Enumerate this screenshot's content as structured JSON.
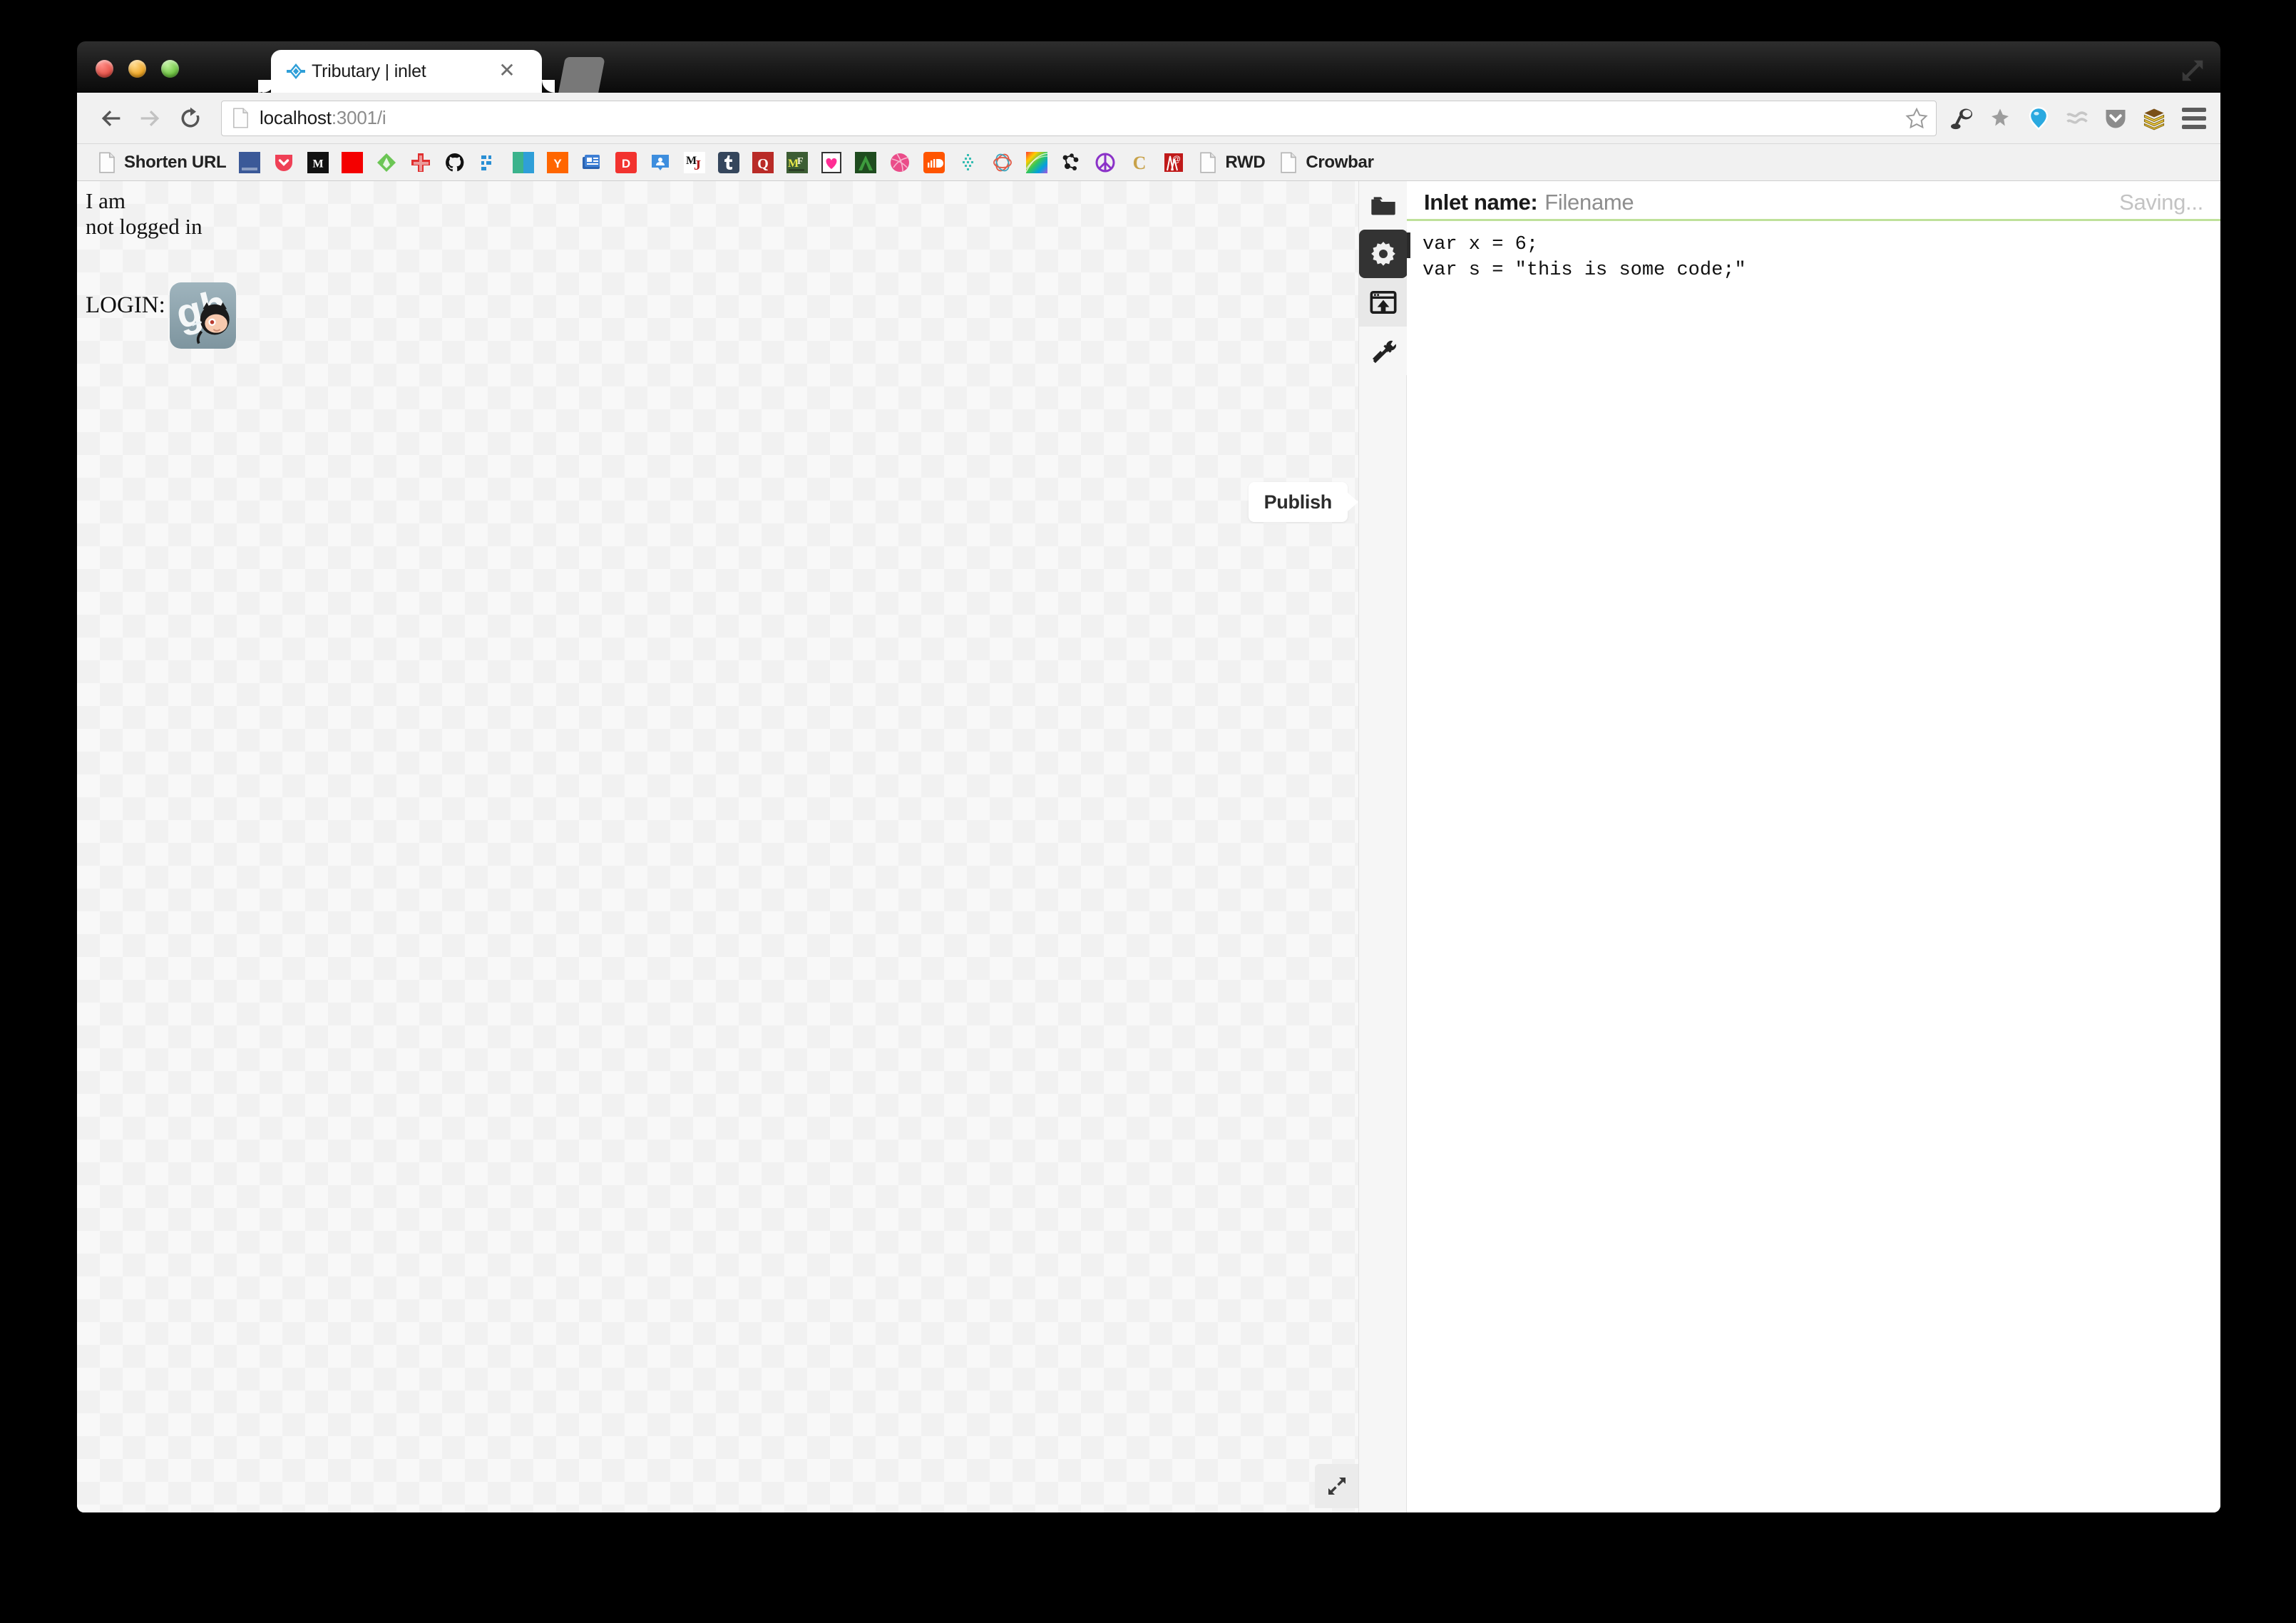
{
  "window": {
    "traffic_lights": [
      "close",
      "minimize",
      "zoom"
    ],
    "fullscreen_icon": "fullscreen-expand-icon"
  },
  "tab": {
    "favicon": "tributary-diamond-icon",
    "title": "Tributary | inlet",
    "close_icon": "close-icon",
    "new_tab_icon": "new-tab-stub"
  },
  "navbar": {
    "back_icon": "back-arrow-icon",
    "forward_icon": "forward-arrow-icon",
    "reload_icon": "reload-icon",
    "page_icon": "page-document-icon",
    "url_host": "localhost",
    "url_path": ":3001/i",
    "url_full": "localhost:3001/i",
    "star_icon": "bookmark-star-icon",
    "menu_icon": "hamburger-menu-icon",
    "extensions": [
      {
        "name": "desk-lamp-icon",
        "color": "#3c3c3c"
      },
      {
        "name": "pushpin-icon",
        "color": "#9a9a9a"
      },
      {
        "name": "blue-teardrop-icon",
        "color": "#1f9fe0"
      },
      {
        "name": "wavy-lines-icon",
        "color": "#c2c2c2"
      },
      {
        "name": "pocket-icon",
        "color": "#8a8a8a"
      },
      {
        "name": "layer-cake-icon",
        "color": "#d8b64a"
      }
    ]
  },
  "bookmarks": [
    {
      "name": "shorten-url",
      "label": "Shorten URL",
      "icon": "page-document-icon",
      "color": "#ffffff"
    },
    {
      "name": "facebook",
      "label": "",
      "icon": "facebook-icon",
      "color": "#3b5998"
    },
    {
      "name": "pocket",
      "label": "",
      "icon": "pocket-shield-icon",
      "color": "#ef4056"
    },
    {
      "name": "medium",
      "label": "",
      "icon": "medium-m-icon",
      "color": "#111111"
    },
    {
      "name": "red-square",
      "label": "",
      "icon": "red-square-icon",
      "color": "#f40000"
    },
    {
      "name": "feedly",
      "label": "",
      "icon": "feedly-leaf-icon",
      "color": "#6cc655"
    },
    {
      "name": "red-cross",
      "label": "",
      "icon": "red-cross-icon",
      "color": "#e03030"
    },
    {
      "name": "github",
      "label": "",
      "icon": "github-octocat-icon",
      "color": "#111111"
    },
    {
      "name": "blue-dots",
      "label": "",
      "icon": "blue-dots-grid-icon",
      "color": "#2a8fd4"
    },
    {
      "name": "teal-blue-split",
      "label": "",
      "icon": "split-rect-icon",
      "color": "#3bb38c"
    },
    {
      "name": "hacker-news",
      "label": "",
      "icon": "hacker-news-y-icon",
      "color": "#ff6600"
    },
    {
      "name": "news-reader",
      "label": "",
      "icon": "newspaper-icon",
      "color": "#2a62b0"
    },
    {
      "name": "dribbble-d",
      "label": "",
      "icon": "letter-d-icon",
      "color": "#f2332f"
    },
    {
      "name": "slideshare",
      "label": "",
      "icon": "presentation-icon",
      "color": "#3e8ede"
    },
    {
      "name": "mj",
      "label": "",
      "icon": "mj-monogram-icon",
      "color": "#ffffff"
    },
    {
      "name": "tumblr",
      "label": "",
      "icon": "tumblr-t-icon",
      "color": "#35465c"
    },
    {
      "name": "quora",
      "label": "",
      "icon": "quora-q-icon",
      "color": "#b92b27"
    },
    {
      "name": "mf",
      "label": "",
      "icon": "mf-monogram-icon",
      "color": "#3c5d34"
    },
    {
      "name": "heart",
      "label": "",
      "icon": "pink-heart-icon",
      "color": "#ff2d94"
    },
    {
      "name": "green-a",
      "label": "",
      "icon": "green-triangle-a-icon",
      "color": "#1f4c1f"
    },
    {
      "name": "dribbble",
      "label": "",
      "icon": "dribbble-ball-icon",
      "color": "#ea4c89"
    },
    {
      "name": "soundcloud",
      "label": "",
      "icon": "soundcloud-icon",
      "color": "#ff5500"
    },
    {
      "name": "teal-dots",
      "label": "",
      "icon": "teal-dot-grid-icon",
      "color": "#35bdb2"
    },
    {
      "name": "knot",
      "label": "",
      "icon": "knot-loop-icon",
      "color": "#e05a47"
    },
    {
      "name": "spectrum",
      "label": "",
      "icon": "rainbow-swirl-icon",
      "color": "#8ad0e8"
    },
    {
      "name": "nodes",
      "label": "",
      "icon": "node-graph-icon",
      "color": "#1b1b1b"
    },
    {
      "name": "peace",
      "label": "",
      "icon": "peace-sign-icon",
      "color": "#8b32c8"
    },
    {
      "name": "codepen-c",
      "label": "",
      "icon": "letter-c-icon",
      "color": "#c8a24a"
    },
    {
      "name": "at-stamp",
      "label": "",
      "icon": "at-sign-stamp-icon",
      "color": "#c01a1a"
    },
    {
      "name": "rwd",
      "label": "RWD",
      "icon": "page-document-icon",
      "color": "#ffffff"
    },
    {
      "name": "crowbar",
      "label": "Crowbar",
      "icon": "page-document-icon",
      "color": "#ffffff"
    }
  ],
  "preview": {
    "line1": "I am",
    "line2": "not logged in",
    "login_label": "LOGIN:",
    "github_login_icon": "github-gh-octocat-login-icon",
    "publish_tooltip": "Publish",
    "resize_icon": "resize-expand-icon"
  },
  "rail": [
    {
      "name": "files-folder",
      "icon": "folder-icon",
      "state": "default"
    },
    {
      "name": "settings",
      "icon": "gear-icon",
      "state": "active"
    },
    {
      "name": "publish",
      "icon": "publish-window-upload-icon",
      "state": "tinted"
    },
    {
      "name": "tools",
      "icon": "hammer-wrench-icon",
      "state": "default"
    }
  ],
  "editor": {
    "name_label": "Inlet name:",
    "name_placeholder": "Filename",
    "name_value": "",
    "save_status": "Saving...",
    "underline_color": "#bfe19a",
    "code": "var x = 6;\nvar s = \"this is some code;\""
  }
}
